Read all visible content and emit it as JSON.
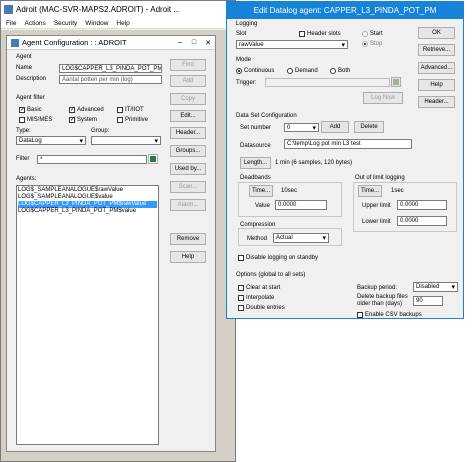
{
  "main_window": {
    "title": "Adroit (MAC-SVR-MAPS2.ADROIT) - Adroit ...",
    "menu": [
      "File",
      "Actions",
      "Security",
      "Window",
      "Help"
    ]
  },
  "agent_config": {
    "title": "Agent Configuration :  : ADROIT",
    "agent_section": "Agent",
    "name_label": "Name",
    "name_value": "LOG$CAPPER_L3_PINDA_POT_PM$RAV",
    "description_label": "Description",
    "description_value": "Aantal potten per min (log)",
    "agent_filter_label": "Agent filter",
    "filters": [
      "Basic",
      "Advanced",
      "IT/IIOT",
      "MIS/MES",
      "System",
      "Primitive"
    ],
    "type_label": "Type:",
    "type_value": "DataLog",
    "group_label": "Group:",
    "group_value": "",
    "filter_label": "Filter",
    "filter_value": "*",
    "agents_label": "Agents:",
    "agents": [
      "LOG$_SAMPLEANALOGUE$rawValue",
      "LOG$_SAMPLEANALOGUE$value",
      "LOG$CAPPER_L3_PINDA_POT_PM$rawValue",
      "LOG$CAPPER_L3_PINDA_POT_PM$value"
    ],
    "buttons": [
      "Find",
      "Add",
      "Copy",
      "Edit...",
      "Header...",
      "Groups...",
      "Used by...",
      "Scan...",
      "Alarm...",
      "Remove",
      "Help"
    ]
  },
  "datalog": {
    "title": "Edit Datalog agent: CAPPER_L3_PINDA_POT_PM",
    "logging": "Logging",
    "slot_label": "Slot",
    "header_slots": "Header slots",
    "slot_value": "rawValue",
    "start": "Start",
    "stop": "Stop",
    "mode": "Mode",
    "continuous": "Continuous",
    "demand": "Demand",
    "both": "Both",
    "trigger_label": "Trigger:",
    "log_now": "Log Now",
    "right_buttons": [
      "OK",
      "Retrieve...",
      "Advanced...",
      "Help",
      "Header..."
    ],
    "dataset_config": "Data Set Configuration",
    "set_number_label": "Set number",
    "set_number_value": "0",
    "add": "Add",
    "delete": "Delete",
    "datasource_label": "Datasource",
    "datasource_value": "C:\\temp\\Log pot min L3 test",
    "length_btn": "Length...",
    "length_text": "1 min (6 samples, 120 bytes)",
    "deadbands": "Deadbands",
    "time_btn": "Time...",
    "deadband_time": "10sec",
    "value_label": "Value",
    "value_value": "0.0000",
    "out_of_limit": "Out of limit logging",
    "oolimit_time": "1sec",
    "upper_label": "Upper limit",
    "upper_value": "0.0000",
    "lower_label": "Lower limit",
    "lower_value": "0.0000",
    "compression": "Compression",
    "method_label": "Method",
    "method_value": "Actual",
    "disable_standby": "Disable logging on standby",
    "options": "Options (global to all sets)",
    "clear_at_start": "Clear at start",
    "interpolate": "Interpolate",
    "double_entries": "Double entries",
    "backup_period_label": "Backup period:",
    "backup_period_value": "Disabled",
    "delete_backup_label": "Delete backup files older than (days)",
    "delete_backup_value": "90",
    "enable_csv": "Enable CSV backups"
  }
}
